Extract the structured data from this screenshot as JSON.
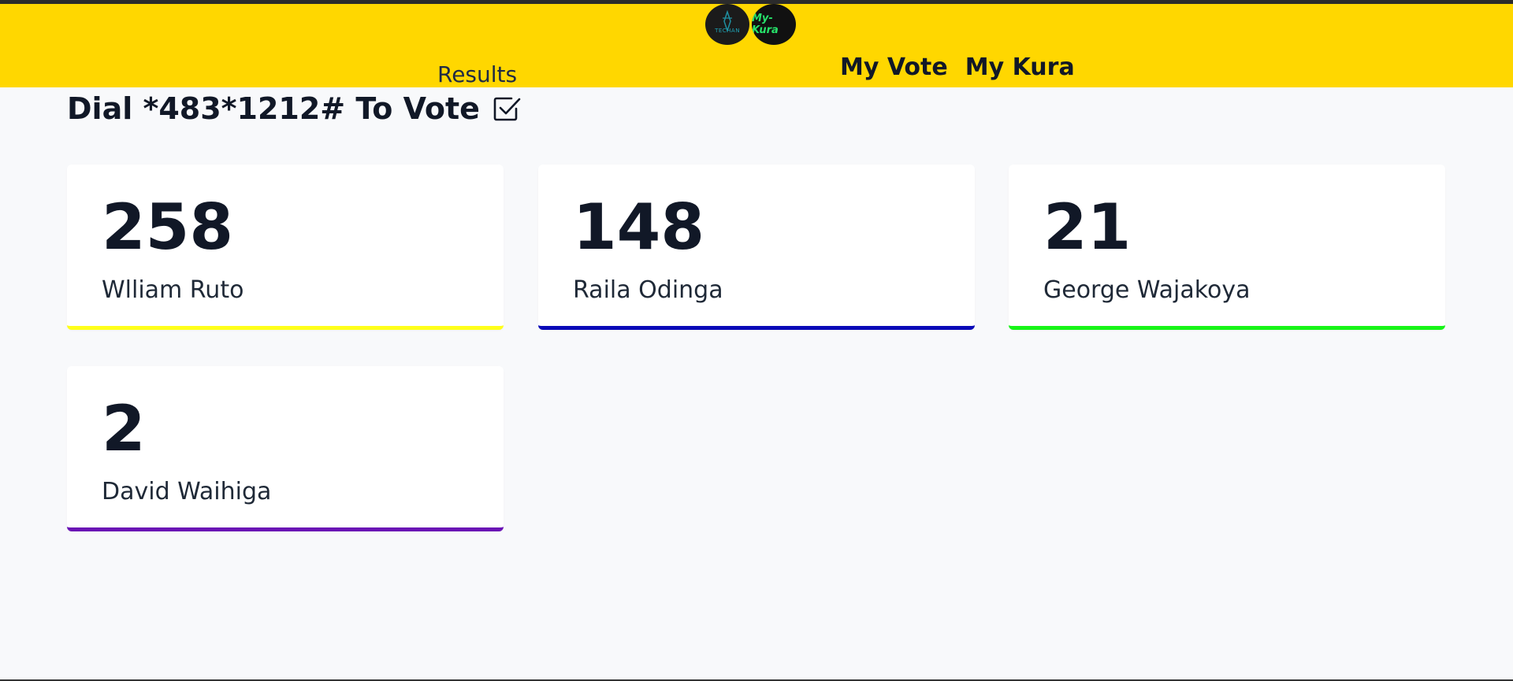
{
  "header": {
    "results_label": "Results",
    "nav": [
      {
        "label": "My Vote"
      },
      {
        "label": "My Kura"
      }
    ],
    "logos": [
      {
        "text": "TECHAN",
        "icon": "techan-logo-icon"
      },
      {
        "text": "My-Kura",
        "icon": "mykura-logo-icon"
      }
    ],
    "color": "#ffd700"
  },
  "dial": {
    "text": "Dial *483*1212# To Vote",
    "icon": "checkbox-checked-icon"
  },
  "candidates": [
    {
      "count": "258",
      "name": "Wlliam Ruto",
      "color": "#ffff1a"
    },
    {
      "count": "148",
      "name": "Raila Odinga",
      "color": "#0a0ab8"
    },
    {
      "count": "21",
      "name": "George Wajakoya",
      "color": "#17f517"
    },
    {
      "count": "2",
      "name": "David Waihiga",
      "color": "#6a12b5"
    }
  ]
}
